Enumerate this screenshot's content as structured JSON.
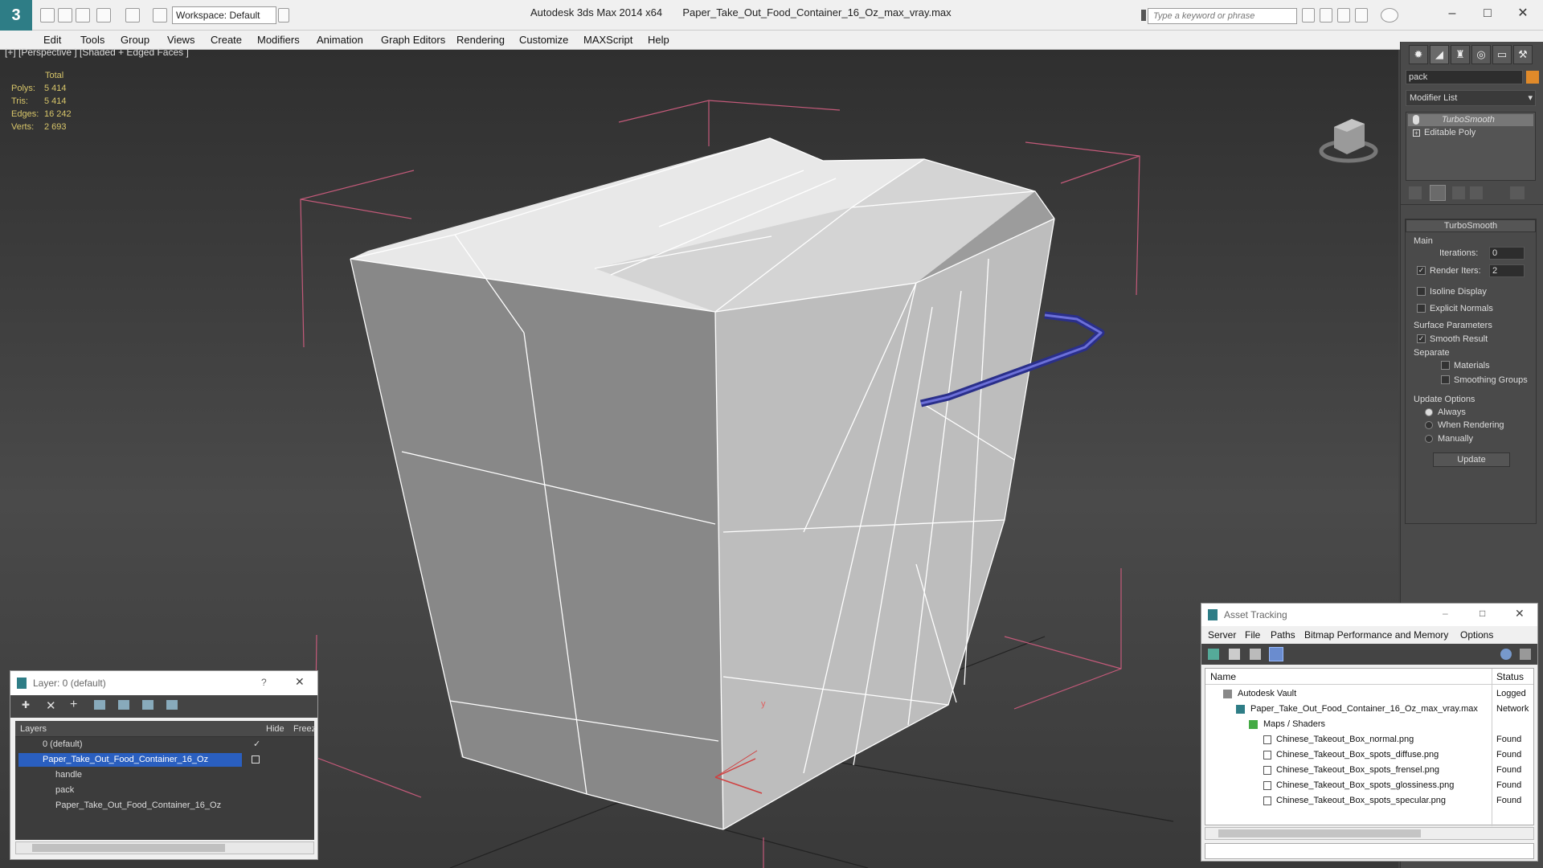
{
  "window": {
    "app_title": "Autodesk 3ds Max  2014 x64",
    "file_title": "Paper_Take_Out_Food_Container_16_Oz_max_vray.max",
    "workspace": "Workspace: Default",
    "search_placeholder": "Type a keyword or phrase"
  },
  "menu": [
    "Edit",
    "Tools",
    "Group",
    "Views",
    "Create",
    "Modifiers",
    "Animation",
    "Graph Editors",
    "Rendering",
    "Customize",
    "MAXScript",
    "Help"
  ],
  "viewport": {
    "label": "[+] [Perspective ] [Shaded + Edged Faces ]",
    "stats": {
      "header": "Total",
      "rows": [
        [
          "Polys:",
          "5 414"
        ],
        [
          "Tris:",
          "5 414"
        ],
        [
          "Edges:",
          "16 242"
        ],
        [
          "Verts:",
          "2 693"
        ]
      ]
    }
  },
  "command_panel": {
    "object_name": "pack",
    "modifier_list": "Modifier List",
    "stack": [
      "TurboSmooth",
      "Editable Poly"
    ],
    "rollout_title": "TurboSmooth",
    "main_label": "Main",
    "iterations_label": "Iterations:",
    "iterations_value": "0",
    "render_iters_label": "Render Iters:",
    "render_iters_value": "2",
    "isoline_display": "Isoline Display",
    "explicit_normals": "Explicit Normals",
    "surface_params": "Surface Parameters",
    "smooth_result": "Smooth Result",
    "separate": "Separate",
    "materials": "Materials",
    "smoothing_groups": "Smoothing Groups",
    "update_options": "Update Options",
    "always": "Always",
    "when_rendering": "When Rendering",
    "manually": "Manually",
    "update_button": "Update"
  },
  "layers": {
    "title": "Layer: 0 (default)",
    "col_layers": "Layers",
    "col_hide": "Hide",
    "col_freeze": "Freez",
    "rows": [
      "0 (default)",
      "Paper_Take_Out_Food_Container_16_Oz",
      "handle",
      "pack",
      "Paper_Take_Out_Food_Container_16_Oz"
    ]
  },
  "asset_tracking": {
    "title": "Asset Tracking",
    "menu": [
      "Server",
      "File",
      "Paths",
      "Bitmap Performance and Memory",
      "Options"
    ],
    "col_name": "Name",
    "col_status": "Status",
    "rows": [
      {
        "name": "Autodesk Vault",
        "status": "Logged"
      },
      {
        "name": "Paper_Take_Out_Food_Container_16_Oz_max_vray.max",
        "status": "Network"
      },
      {
        "name": "Maps / Shaders",
        "status": ""
      },
      {
        "name": "Chinese_Takeout_Box_normal.png",
        "status": "Found"
      },
      {
        "name": "Chinese_Takeout_Box_spots_diffuse.png",
        "status": "Found"
      },
      {
        "name": "Chinese_Takeout_Box_spots_frensel.png",
        "status": "Found"
      },
      {
        "name": "Chinese_Takeout_Box_spots_glossiness.png",
        "status": "Found"
      },
      {
        "name": "Chinese_Takeout_Box_spots_specular.png",
        "status": "Found"
      }
    ]
  },
  "gizmo_axis": "y"
}
